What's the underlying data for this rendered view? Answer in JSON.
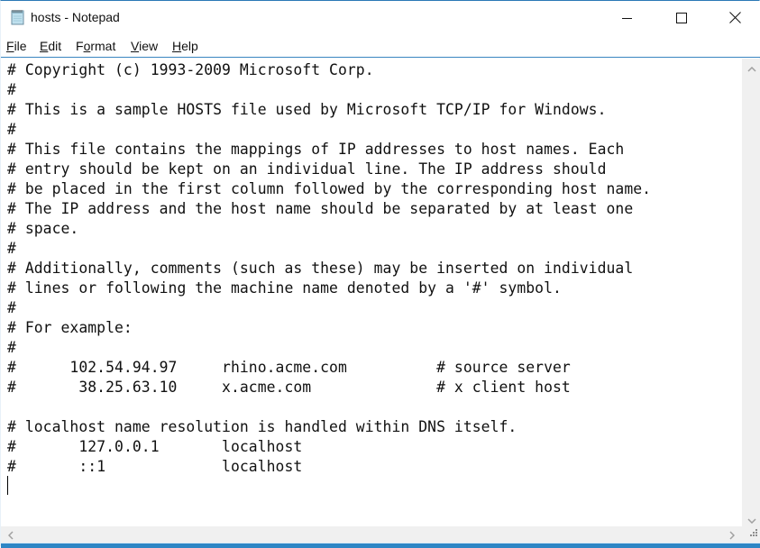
{
  "window": {
    "title": "hosts - Notepad",
    "app_icon": "notepad-icon",
    "controls": {
      "minimize": "minimize-icon",
      "maximize": "maximize-icon",
      "close": "close-icon"
    }
  },
  "menu": [
    {
      "label": "File",
      "accel": "F",
      "rest": "ile"
    },
    {
      "label": "Edit",
      "accel": "E",
      "rest": "dit"
    },
    {
      "label": "Format",
      "accel": "o",
      "pre": "F",
      "rest": "rmat"
    },
    {
      "label": "View",
      "accel": "V",
      "rest": "iew"
    },
    {
      "label": "Help",
      "accel": "H",
      "rest": "elp"
    }
  ],
  "document": {
    "content": "# Copyright (c) 1993-2009 Microsoft Corp.\n#\n# This is a sample HOSTS file used by Microsoft TCP/IP for Windows.\n#\n# This file contains the mappings of IP addresses to host names. Each\n# entry should be kept on an individual line. The IP address should\n# be placed in the first column followed by the corresponding host name.\n# The IP address and the host name should be separated by at least one\n# space.\n#\n# Additionally, comments (such as these) may be inserted on individual\n# lines or following the machine name denoted by a '#' symbol.\n#\n# For example:\n#\n#      102.54.94.97     rhino.acme.com          # source server\n#       38.25.63.10     x.acme.com              # x client host\n\n# localhost name resolution is handled within DNS itself.\n#\t127.0.0.1       localhost\n#\t::1             localhost\n"
  },
  "scrollbars": {
    "vertical": {
      "up": "chevron-up-icon",
      "down": "chevron-down-icon"
    },
    "horizontal": {
      "left": "chevron-left-icon",
      "right": "chevron-right-icon"
    },
    "grip": "resize-grip-icon"
  },
  "colors": {
    "accent": "#2e86c5",
    "scrollbar": "#f0f0f0",
    "text": "#111111"
  }
}
